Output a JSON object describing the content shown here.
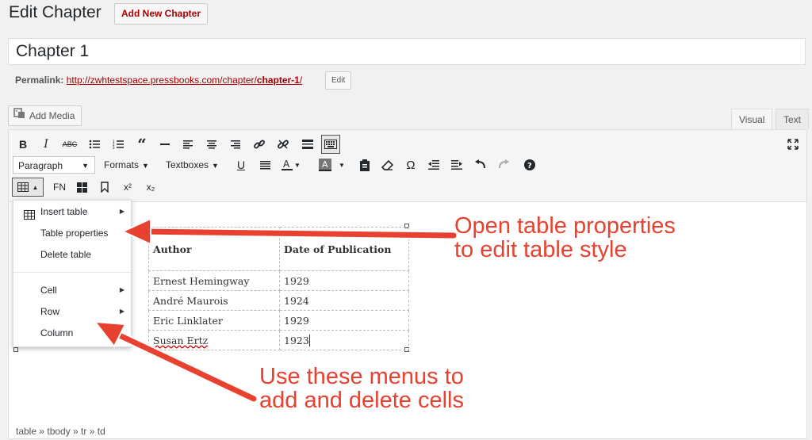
{
  "page": {
    "title": "Edit Chapter",
    "add_new_label": "Add New Chapter"
  },
  "post": {
    "title_value": "Chapter 1",
    "permalink_label": "Permalink:",
    "permalink_base": "http://zwhtestspace.pressbooks.com/chapter/",
    "permalink_slug": "chapter-1",
    "permalink_trail": "/",
    "edit_label": "Edit"
  },
  "editor": {
    "add_media_label": "Add Media",
    "tabs": {
      "visual": "Visual",
      "text": "Text"
    },
    "toolbar": {
      "row1": [
        "bold-icon",
        "italic-icon",
        "strikethrough-icon",
        "bulleted-list-icon",
        "numbered-list-icon",
        "blockquote-icon",
        "horizontal-rule-icon",
        "align-left-icon",
        "align-center-icon",
        "align-right-icon",
        "insert-link-icon",
        "remove-link-icon",
        "read-more-icon",
        "toolbar-toggle-icon"
      ],
      "row2_selects": {
        "paragraph": "Paragraph",
        "formats": "Formats",
        "textboxes": "Textboxes"
      },
      "row3": {
        "fn": "FN",
        "superscript": "x²",
        "subscript": "x₂"
      }
    },
    "status_path": "table » tbody » tr » td"
  },
  "table_menu": {
    "items": [
      {
        "label": "Insert table",
        "submenu": true
      },
      {
        "label": "Table properties",
        "submenu": false
      },
      {
        "label": "Delete table",
        "submenu": false
      },
      {
        "label": "Cell",
        "submenu": true
      },
      {
        "label": "Row",
        "submenu": true
      },
      {
        "label": "Column",
        "submenu": false
      }
    ]
  },
  "content_table": {
    "headers": [
      "Author",
      "Date of Publication"
    ],
    "rows": [
      [
        "Ernest Hemingway",
        "1929"
      ],
      [
        "André Maurois",
        "1924"
      ],
      [
        "Eric Linklater",
        "1929"
      ],
      [
        "Susan Ertz",
        "1923"
      ]
    ]
  },
  "annotations": {
    "top": [
      "Open table properties",
      "to edit table style"
    ],
    "bottom": [
      "Use these menus to",
      "add and delete cells"
    ]
  },
  "colors": {
    "accent": "#e8412f",
    "link": "#aa0000"
  }
}
